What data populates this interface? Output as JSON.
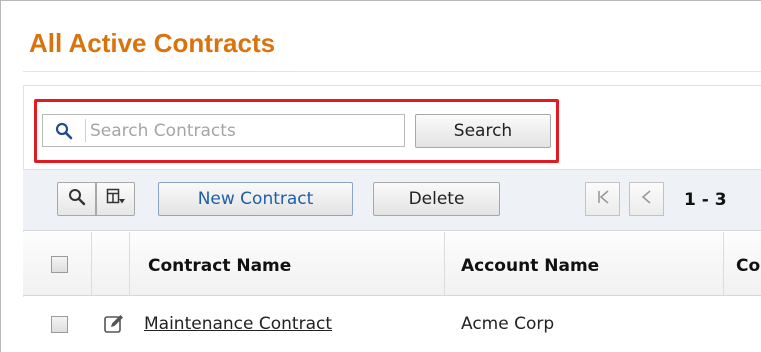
{
  "page": {
    "title": "All Active Contracts"
  },
  "search": {
    "placeholder": "Search Contracts",
    "value": "",
    "button_label": "Search"
  },
  "toolbar": {
    "search_icon": "search-icon",
    "columns_icon": "columns-icon",
    "new_label": "New Contract",
    "delete_label": "Delete",
    "pager_first_icon": "first-page-icon",
    "pager_prev_icon": "previous-page-icon",
    "range_label": "1 - 3"
  },
  "table": {
    "columns": [
      "Contract Name",
      "Account Name",
      "Co"
    ],
    "rows": [
      {
        "contract_name": "Maintenance Contract",
        "account_name": "Acme Corp",
        "edit_icon": "edit-icon"
      }
    ]
  },
  "colors": {
    "title": "#d9730d",
    "highlight": "#e21b23",
    "link": "#1f5fa9"
  }
}
